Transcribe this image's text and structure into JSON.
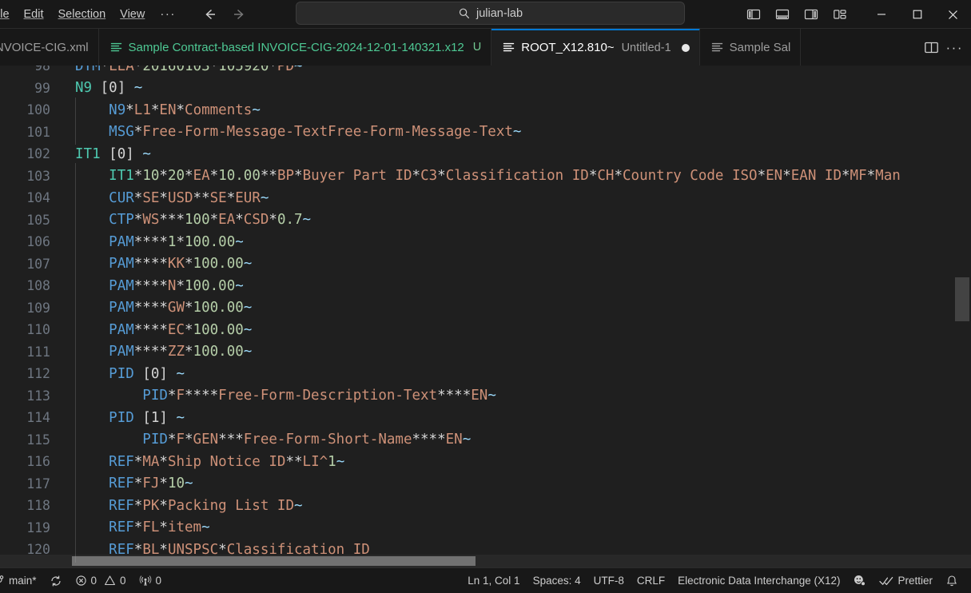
{
  "titlebar": {
    "menu": [
      {
        "label": "ile",
        "name": "menu-file",
        "clipped": true
      },
      {
        "label": "Edit",
        "name": "menu-edit",
        "clipped": false
      },
      {
        "label": "Selection",
        "name": "menu-selection",
        "clipped": false
      },
      {
        "label": "View",
        "name": "menu-view",
        "clipped": false
      }
    ],
    "menu_overflow": "···",
    "nav_back_icon": "arrow-left-icon",
    "nav_forward_icon": "arrow-right-icon",
    "command_center": {
      "icon": "search-icon",
      "text": "julian-lab"
    },
    "layout_buttons": [
      {
        "name": "toggle-primary-sidebar-button",
        "icon": "layout-sidebar-left-icon"
      },
      {
        "name": "toggle-panel-button",
        "icon": "layout-panel-icon"
      },
      {
        "name": "toggle-secondary-sidebar-button",
        "icon": "layout-sidebar-right-icon"
      },
      {
        "name": "customize-layout-button",
        "icon": "layout-customize-icon"
      }
    ],
    "window_controls": [
      {
        "name": "minimize-button",
        "icon": "minimize-icon"
      },
      {
        "name": "maximize-button",
        "icon": "maximize-icon"
      },
      {
        "name": "close-button",
        "icon": "close-icon"
      }
    ]
  },
  "tabs": [
    {
      "name": "tab-invoice-cig-xml",
      "label": "ct-based INVOICE-CIG.xml",
      "color": "grey",
      "icon": "file-lines-icon",
      "active": false,
      "clipped": true,
      "badge": "",
      "description": "",
      "dirty": false
    },
    {
      "name": "tab-sample-contract-invoice-x12",
      "label": "Sample Contract-based INVOICE-CIG-2024-12-01-140321.x12",
      "color": "green",
      "icon": "file-lines-icon",
      "active": false,
      "clipped": false,
      "badge": "U",
      "description": "",
      "dirty": false
    },
    {
      "name": "tab-root-x12-810-untitled-1",
      "label": "ROOT_X12.810~",
      "color": "white",
      "icon": "file-lines-icon",
      "active": true,
      "clipped": false,
      "badge": "",
      "description": "Untitled-1",
      "dirty": true
    },
    {
      "name": "tab-sample-sal",
      "label": "Sample Sal",
      "color": "grey",
      "icon": "file-lines-icon",
      "active": false,
      "clipped": false,
      "badge": "",
      "description": "",
      "dirty": false
    }
  ],
  "tabbar_actions": [
    {
      "name": "split-editor-button",
      "icon": "split-editor-icon"
    },
    {
      "name": "editor-more-actions-button",
      "icon": "ellipsis-icon"
    }
  ],
  "editor": {
    "language": "x12",
    "first_visible_line": 98,
    "lines": [
      {
        "n": 98,
        "indent": 0,
        "clipped": true,
        "tokens": [
          [
            "seg",
            "DTM"
          ],
          [
            "punc",
            "*"
          ],
          [
            "val",
            "LEA"
          ],
          [
            "punc",
            "*"
          ],
          [
            "num",
            "20160103"
          ],
          [
            "punc",
            "*"
          ],
          [
            "num",
            "105920"
          ],
          [
            "punc",
            "*"
          ],
          [
            "val",
            "PD"
          ],
          [
            "tilde",
            "~"
          ]
        ]
      },
      {
        "n": 99,
        "indent": 0,
        "clipped": false,
        "tokens": [
          [
            "loop",
            "N9"
          ],
          [
            "punc",
            " "
          ],
          [
            "brk",
            "[0]"
          ],
          [
            "punc",
            " "
          ],
          [
            "tilde",
            "~"
          ]
        ]
      },
      {
        "n": 100,
        "indent": 1,
        "clipped": false,
        "tokens": [
          [
            "seg",
            "N9"
          ],
          [
            "punc",
            "*"
          ],
          [
            "val",
            "L1"
          ],
          [
            "punc",
            "*"
          ],
          [
            "val",
            "EN"
          ],
          [
            "punc",
            "*"
          ],
          [
            "val",
            "Comments"
          ],
          [
            "tilde",
            "~"
          ]
        ]
      },
      {
        "n": 101,
        "indent": 1,
        "clipped": false,
        "tokens": [
          [
            "seg",
            "MSG"
          ],
          [
            "punc",
            "*"
          ],
          [
            "val",
            "Free-Form-Message-TextFree-Form-Message-Text"
          ],
          [
            "tilde",
            "~"
          ]
        ]
      },
      {
        "n": 102,
        "indent": 0,
        "clipped": false,
        "tokens": [
          [
            "loop",
            "IT1"
          ],
          [
            "punc",
            " "
          ],
          [
            "brk",
            "[0]"
          ],
          [
            "punc",
            " "
          ],
          [
            "tilde",
            "~"
          ]
        ]
      },
      {
        "n": 103,
        "indent": 1,
        "clipped": false,
        "tokens": [
          [
            "loop",
            "IT1"
          ],
          [
            "punc",
            "*"
          ],
          [
            "num",
            "10"
          ],
          [
            "punc",
            "*"
          ],
          [
            "num",
            "20"
          ],
          [
            "punc",
            "*"
          ],
          [
            "val",
            "EA"
          ],
          [
            "punc",
            "*"
          ],
          [
            "num",
            "10.00"
          ],
          [
            "punc",
            "**"
          ],
          [
            "val",
            "BP"
          ],
          [
            "punc",
            "*"
          ],
          [
            "val",
            "Buyer Part ID"
          ],
          [
            "punc",
            "*"
          ],
          [
            "val",
            "C3"
          ],
          [
            "punc",
            "*"
          ],
          [
            "val",
            "Classification ID"
          ],
          [
            "punc",
            "*"
          ],
          [
            "val",
            "CH"
          ],
          [
            "punc",
            "*"
          ],
          [
            "val",
            "Country Code ISO"
          ],
          [
            "punc",
            "*"
          ],
          [
            "val",
            "EN"
          ],
          [
            "punc",
            "*"
          ],
          [
            "val",
            "EAN ID"
          ],
          [
            "punc",
            "*"
          ],
          [
            "val",
            "MF"
          ],
          [
            "punc",
            "*"
          ],
          [
            "val",
            "Man"
          ]
        ]
      },
      {
        "n": 104,
        "indent": 1,
        "clipped": false,
        "tokens": [
          [
            "seg",
            "CUR"
          ],
          [
            "punc",
            "*"
          ],
          [
            "val",
            "SE"
          ],
          [
            "punc",
            "*"
          ],
          [
            "val",
            "USD"
          ],
          [
            "punc",
            "**"
          ],
          [
            "val",
            "SE"
          ],
          [
            "punc",
            "*"
          ],
          [
            "val",
            "EUR"
          ],
          [
            "tilde",
            "~"
          ]
        ]
      },
      {
        "n": 105,
        "indent": 1,
        "clipped": false,
        "tokens": [
          [
            "seg",
            "CTP"
          ],
          [
            "punc",
            "*"
          ],
          [
            "val",
            "WS"
          ],
          [
            "punc",
            "***"
          ],
          [
            "num",
            "100"
          ],
          [
            "punc",
            "*"
          ],
          [
            "val",
            "EA"
          ],
          [
            "punc",
            "*"
          ],
          [
            "val",
            "CSD"
          ],
          [
            "punc",
            "*"
          ],
          [
            "num",
            "0.7"
          ],
          [
            "tilde",
            "~"
          ]
        ]
      },
      {
        "n": 106,
        "indent": 1,
        "clipped": false,
        "tokens": [
          [
            "seg",
            "PAM"
          ],
          [
            "punc",
            "****"
          ],
          [
            "num",
            "1"
          ],
          [
            "punc",
            "*"
          ],
          [
            "num",
            "100.00"
          ],
          [
            "tilde",
            "~"
          ]
        ]
      },
      {
        "n": 107,
        "indent": 1,
        "clipped": false,
        "tokens": [
          [
            "seg",
            "PAM"
          ],
          [
            "punc",
            "****"
          ],
          [
            "val",
            "KK"
          ],
          [
            "punc",
            "*"
          ],
          [
            "num",
            "100.00"
          ],
          [
            "tilde",
            "~"
          ]
        ]
      },
      {
        "n": 108,
        "indent": 1,
        "clipped": false,
        "tokens": [
          [
            "seg",
            "PAM"
          ],
          [
            "punc",
            "****"
          ],
          [
            "val",
            "N"
          ],
          [
            "punc",
            "*"
          ],
          [
            "num",
            "100.00"
          ],
          [
            "tilde",
            "~"
          ]
        ]
      },
      {
        "n": 109,
        "indent": 1,
        "clipped": false,
        "tokens": [
          [
            "seg",
            "PAM"
          ],
          [
            "punc",
            "****"
          ],
          [
            "val",
            "GW"
          ],
          [
            "punc",
            "*"
          ],
          [
            "num",
            "100.00"
          ],
          [
            "tilde",
            "~"
          ]
        ]
      },
      {
        "n": 110,
        "indent": 1,
        "clipped": false,
        "tokens": [
          [
            "seg",
            "PAM"
          ],
          [
            "punc",
            "****"
          ],
          [
            "val",
            "EC"
          ],
          [
            "punc",
            "*"
          ],
          [
            "num",
            "100.00"
          ],
          [
            "tilde",
            "~"
          ]
        ]
      },
      {
        "n": 111,
        "indent": 1,
        "clipped": false,
        "tokens": [
          [
            "seg",
            "PAM"
          ],
          [
            "punc",
            "****"
          ],
          [
            "val",
            "ZZ"
          ],
          [
            "punc",
            "*"
          ],
          [
            "num",
            "100.00"
          ],
          [
            "tilde",
            "~"
          ]
        ]
      },
      {
        "n": 112,
        "indent": 1,
        "clipped": false,
        "tokens": [
          [
            "seg",
            "PID"
          ],
          [
            "punc",
            " "
          ],
          [
            "brk",
            "[0]"
          ],
          [
            "punc",
            " "
          ],
          [
            "tilde",
            "~"
          ]
        ]
      },
      {
        "n": 113,
        "indent": 2,
        "clipped": false,
        "tokens": [
          [
            "seg",
            "PID"
          ],
          [
            "punc",
            "*"
          ],
          [
            "val",
            "F"
          ],
          [
            "punc",
            "****"
          ],
          [
            "val",
            "Free-Form-Description-Text"
          ],
          [
            "punc",
            "****"
          ],
          [
            "val",
            "EN"
          ],
          [
            "tilde",
            "~"
          ]
        ]
      },
      {
        "n": 114,
        "indent": 1,
        "clipped": false,
        "tokens": [
          [
            "seg",
            "PID"
          ],
          [
            "punc",
            " "
          ],
          [
            "brk",
            "[1]"
          ],
          [
            "punc",
            " "
          ],
          [
            "tilde",
            "~"
          ]
        ]
      },
      {
        "n": 115,
        "indent": 2,
        "clipped": false,
        "tokens": [
          [
            "seg",
            "PID"
          ],
          [
            "punc",
            "*"
          ],
          [
            "val",
            "F"
          ],
          [
            "punc",
            "*"
          ],
          [
            "val",
            "GEN"
          ],
          [
            "punc",
            "***"
          ],
          [
            "val",
            "Free-Form-Short-Name"
          ],
          [
            "punc",
            "****"
          ],
          [
            "val",
            "EN"
          ],
          [
            "tilde",
            "~"
          ]
        ]
      },
      {
        "n": 116,
        "indent": 1,
        "clipped": false,
        "tokens": [
          [
            "seg",
            "REF"
          ],
          [
            "punc",
            "*"
          ],
          [
            "val",
            "MA"
          ],
          [
            "punc",
            "*"
          ],
          [
            "val",
            "Ship Notice ID"
          ],
          [
            "punc",
            "**"
          ],
          [
            "val",
            "LI^"
          ],
          [
            "num",
            "1"
          ],
          [
            "tilde",
            "~"
          ]
        ]
      },
      {
        "n": 117,
        "indent": 1,
        "clipped": false,
        "tokens": [
          [
            "seg",
            "REF"
          ],
          [
            "punc",
            "*"
          ],
          [
            "val",
            "FJ"
          ],
          [
            "punc",
            "*"
          ],
          [
            "num",
            "10"
          ],
          [
            "tilde",
            "~"
          ]
        ]
      },
      {
        "n": 118,
        "indent": 1,
        "clipped": false,
        "tokens": [
          [
            "seg",
            "REF"
          ],
          [
            "punc",
            "*"
          ],
          [
            "val",
            "PK"
          ],
          [
            "punc",
            "*"
          ],
          [
            "val",
            "Packing List ID"
          ],
          [
            "tilde",
            "~"
          ]
        ]
      },
      {
        "n": 119,
        "indent": 1,
        "clipped": false,
        "tokens": [
          [
            "seg",
            "REF"
          ],
          [
            "punc",
            "*"
          ],
          [
            "val",
            "FL"
          ],
          [
            "punc",
            "*"
          ],
          [
            "val",
            "item"
          ],
          [
            "tilde",
            "~"
          ]
        ]
      },
      {
        "n": 120,
        "indent": 1,
        "clipped": false,
        "tokens": [
          [
            "seg",
            "REF"
          ],
          [
            "punc",
            "*"
          ],
          [
            "val",
            "BL"
          ],
          [
            "punc",
            "*"
          ],
          [
            "val",
            "UNSPSC"
          ],
          [
            "punc",
            "*"
          ],
          [
            "val",
            "Classification ID"
          ]
        ]
      }
    ]
  },
  "statusbar": {
    "left": [
      {
        "name": "status-branch",
        "icon": "source-control-icon",
        "label": "main*"
      },
      {
        "name": "status-sync",
        "icon": "sync-icon",
        "label": ""
      },
      {
        "name": "status-problems",
        "icon": "error-icon",
        "label": "0",
        "icon2": "warning-icon",
        "label2": "0"
      },
      {
        "name": "status-ports",
        "icon": "radio-tower-icon",
        "label": "0"
      }
    ],
    "right": [
      {
        "name": "status-cursor-position",
        "label": "Ln 1, Col 1"
      },
      {
        "name": "status-indentation",
        "label": "Spaces: 4"
      },
      {
        "name": "status-encoding",
        "label": "UTF-8"
      },
      {
        "name": "status-eol",
        "label": "CRLF"
      },
      {
        "name": "status-language-mode",
        "label": "Electronic Data Interchange (X12)"
      },
      {
        "name": "status-feedback",
        "icon": "feedback-smiley-icon",
        "label": ""
      },
      {
        "name": "status-prettier",
        "icon": "check-all-icon",
        "label": "Prettier"
      },
      {
        "name": "status-notifications",
        "icon": "bell-icon",
        "label": ""
      }
    ]
  },
  "colors": {
    "background": "#1f1f1f",
    "chrome": "#181818",
    "accent": "#0078d4",
    "segment": "#569cd6",
    "loop": "#4ec9b0",
    "value": "#ce9178",
    "number": "#b5cea8",
    "tilde": "#9cdcfe",
    "line_number": "#6e7681",
    "tab_green": "#4ec994"
  }
}
